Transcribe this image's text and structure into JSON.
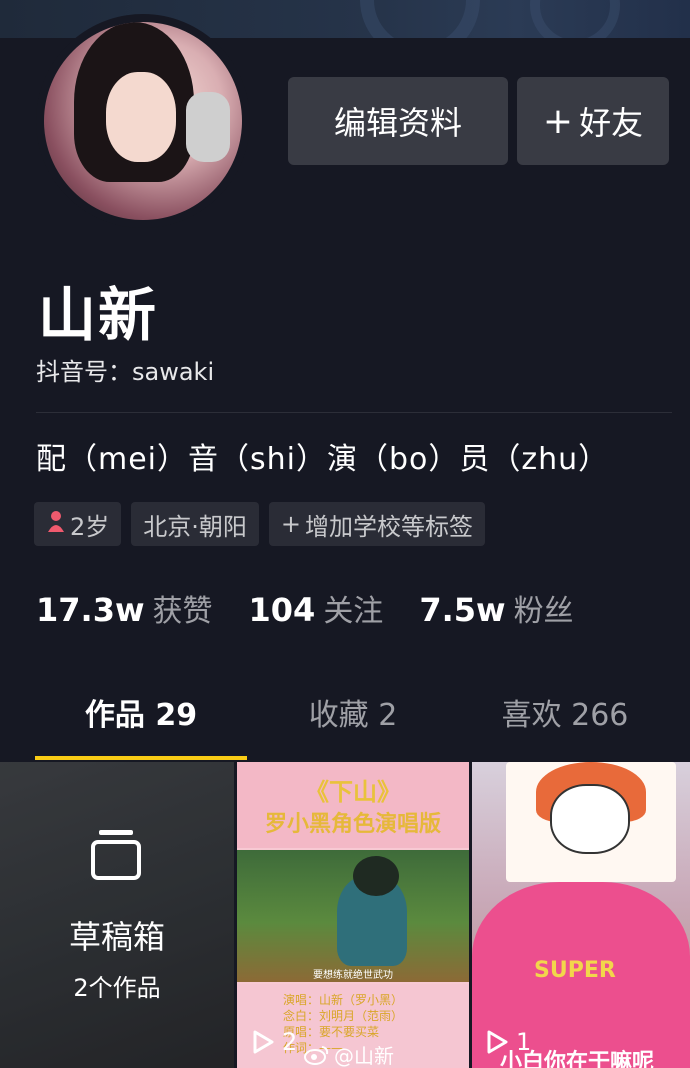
{
  "profile": {
    "nickname": "山新",
    "douyin_id": "抖音号：sawaki",
    "bio": "配（mei）音（shi）演（bo）员（zhu）"
  },
  "actions": {
    "edit_label": "编辑资料",
    "friend_label": "好友",
    "friend_icon": "plus-icon"
  },
  "tags": {
    "age": "2岁",
    "location": "北京·朝阳",
    "add_label": "增加学校等标签"
  },
  "stats": [
    {
      "value": "17.3w",
      "label": "获赞"
    },
    {
      "value": "104",
      "label": "关注"
    },
    {
      "value": "7.5w",
      "label": "粉丝"
    }
  ],
  "tabs": [
    {
      "label": "作品 29",
      "active": true
    },
    {
      "label": "收藏 2",
      "active": false
    },
    {
      "label": "喜欢 266",
      "active": false
    }
  ],
  "accent_color": "#facc15",
  "grid": {
    "draft": {
      "title": "草稿箱",
      "count": "2个作品"
    },
    "video2": {
      "title1": "《下山》",
      "title2": "罗小黑角色演唱版",
      "caption": "要想练就绝世武功",
      "credits": [
        "演唱：山新（罗小黑）",
        "念白：刘明月（范雨）",
        "原唱：要不要买菜",
        "作词：——"
      ],
      "plays": "2"
    },
    "video3": {
      "shirt_text": "SUPER",
      "subtitle": "小白你在干嘛呢",
      "plays": "1"
    }
  },
  "watermark": "@山新"
}
